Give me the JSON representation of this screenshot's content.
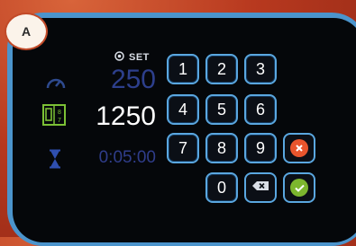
{
  "badge": {
    "label": "A"
  },
  "set_label": "SET",
  "readings": {
    "speed": "250",
    "weight": "1250",
    "time": "0:05:00"
  },
  "keypad": {
    "keys": [
      "1",
      "2",
      "3",
      "4",
      "5",
      "6",
      "7",
      "8",
      "9",
      "0"
    ]
  },
  "colors": {
    "bezel": "#4b94cc",
    "key_border": "#5aa7e0",
    "cancel": "#e8552d",
    "confirm": "#7cb62e"
  }
}
